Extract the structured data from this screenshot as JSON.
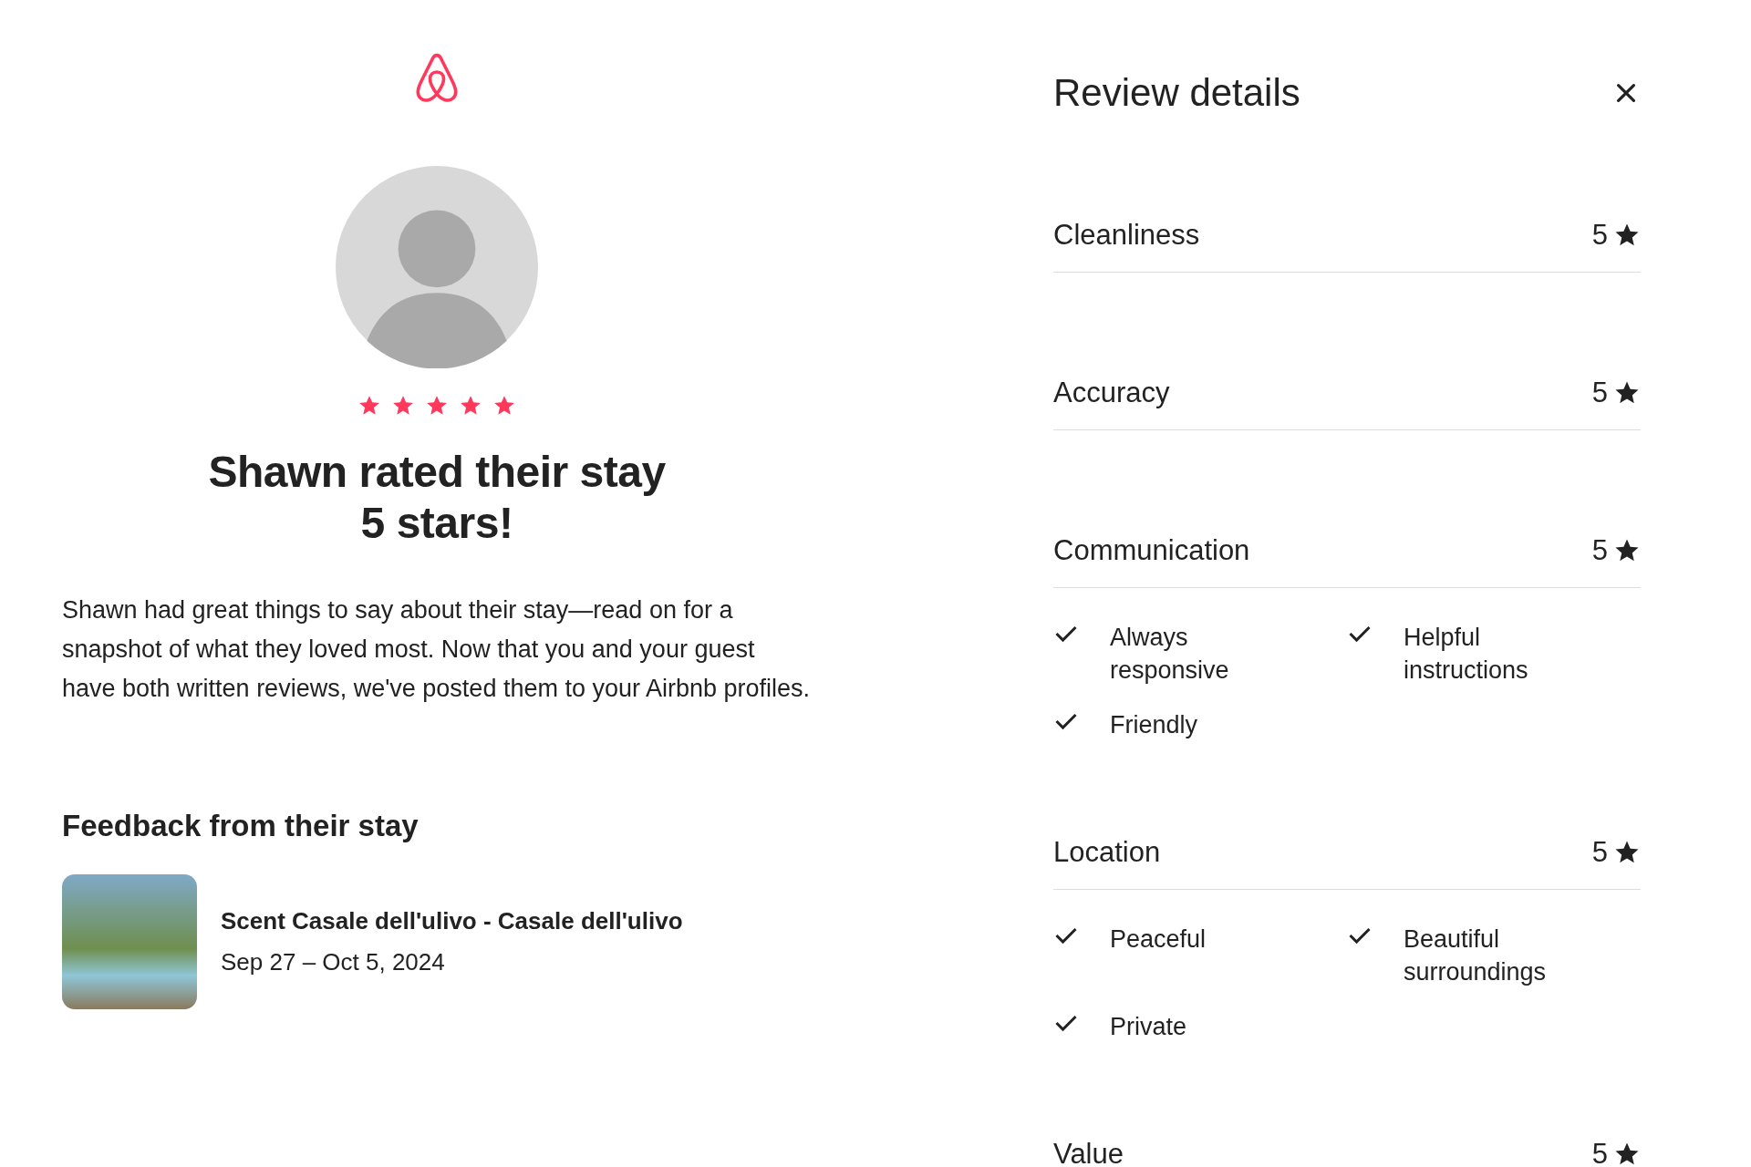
{
  "review": {
    "stars": 5,
    "headline_line1": "Shawn rated their stay",
    "headline_line2": "5 stars!",
    "body": "Shawn had great things to say about their stay—read on for a snapshot of what they loved most. Now that you and your guest have both written reviews, we've posted them to your Airbnb profiles."
  },
  "feedback": {
    "heading": "Feedback from their stay",
    "listing": {
      "title": "Scent Casale dell'ulivo - Casale dell'ulivo",
      "dates": "Sep 27 – Oct 5, 2024"
    }
  },
  "details": {
    "title": "Review details",
    "categories": [
      {
        "name": "Cleanliness",
        "score": "5"
      },
      {
        "name": "Accuracy",
        "score": "5"
      },
      {
        "name": "Communication",
        "score": "5",
        "tags": [
          "Always responsive",
          "Helpful instructions",
          "Friendly"
        ]
      },
      {
        "name": "Location",
        "score": "5",
        "tags": [
          "Peaceful",
          "Beautiful surroundings",
          "Private"
        ]
      },
      {
        "name": "Value",
        "score": "5"
      }
    ]
  }
}
